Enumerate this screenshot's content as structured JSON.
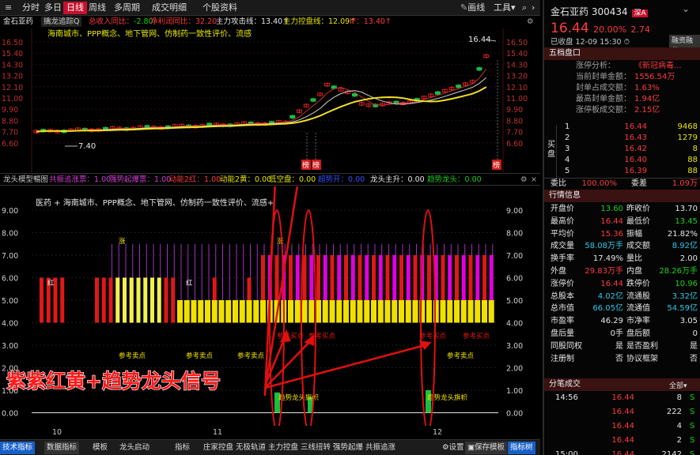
{
  "toolbar": {
    "tabs": [
      "分时",
      "多日",
      "日线",
      "周线",
      "多周期",
      "成交明细",
      "个股资料"
    ],
    "active_tab": "日线",
    "right_buttons": [
      "画线",
      "工具"
    ]
  },
  "info_line": {
    "stock": "金石亚药",
    "indicator": "擒龙追踪Q",
    "items": [
      {
        "label": "总收入同比：",
        "value": "-2.80"
      },
      {
        "label": "净利润同比：",
        "value": "32.20"
      },
      {
        "label": "主力攻击线：",
        "value": "13.40↑"
      },
      {
        "label": "主力控盘线：",
        "value": "12.09↑"
      },
      {
        "label": "IF：",
        "value": "13.40↑"
      }
    ],
    "concepts": "海南城市、PPP概念、地下管网、仿制药一致性评价、流感"
  },
  "price_chart": {
    "y_ticks": [
      "16.50",
      "15.40",
      "14.30",
      "13.20",
      "12.10",
      "11.00",
      "9.90",
      "8.80",
      "7.70",
      "6.60"
    ],
    "high_label": "16.44",
    "low_label": "7.40",
    "badges": [
      "榜",
      "榜",
      "榜"
    ]
  },
  "mid_bar": {
    "title": "龙头模型暢图",
    "items": [
      {
        "label": "共振追涨票：",
        "value": "1.00"
      },
      {
        "label": "强势起爆票：",
        "value": "1.00"
      },
      {
        "label": "动能2红：",
        "value": "1.00"
      },
      {
        "label": "动能2黄：",
        "value": "0.00"
      },
      {
        "label": "低空盘：",
        "value": "0.00"
      },
      {
        "label": "超势开：",
        "value": "0.00"
      },
      {
        "label": "龙头主升：",
        "value": "0.00"
      },
      {
        "label": "趋势龙头：",
        "value": "0.00"
      }
    ]
  },
  "signal_chart": {
    "concepts": "医药 + 海南城市、PPP概念、地下管网、仿制药一致性评价、流感+",
    "y_ticks": [
      "9.00",
      "8.00",
      "7.00",
      "6.00",
      "5.00",
      "4.00",
      "3.00",
      "2.00",
      "1.00",
      "0.00"
    ],
    "tag_red": "红",
    "tag_zhang": "涨",
    "ref_buy": "参考买点",
    "ref_sell": "参考卖点",
    "trend_flag": "趋势龙头旗帜",
    "annotation": "紫紫红黄+趋势龙头信号"
  },
  "x_axis": {
    "labels": [
      "10",
      "11",
      "12"
    ]
  },
  "bottom_tabs": [
    "技术指标",
    "数据指标",
    "模板",
    "龙头启动",
    "指标",
    "庄家控盘",
    "无极轨道",
    "主力控盘",
    "三线扭转",
    "强势起爆",
    "共振追涨"
  ],
  "bottom_right": [
    "设置",
    "保存模板",
    "指标树"
  ],
  "quote": {
    "name": "金石亚药",
    "code": "300434",
    "market": "深A",
    "price": "16.44",
    "change_pct": "20.00%",
    "change": "2.74",
    "status": "已收盘",
    "date": "12-09",
    "time": "15:30",
    "panel_btn": "融资融券"
  },
  "fivelevel": {
    "title": "五档盘口",
    "rows": [
      {
        "label": "涨停分析：",
        "value": "《新冠病毒..."
      },
      {
        "label": "当前封单金额：",
        "value": "1556.54万"
      },
      {
        "label": "封单占成交额：",
        "value": "1.63%"
      },
      {
        "label": "最高封单金额：",
        "value": "1.94亿"
      },
      {
        "label": "涨停板成交额：",
        "value": "2.15亿"
      }
    ],
    "side_label": "买盘",
    "bids": [
      {
        "lvl": "1",
        "price": "16.44",
        "vol": "9468"
      },
      {
        "lvl": "2",
        "price": "16.43",
        "vol": "1279"
      },
      {
        "lvl": "3",
        "price": "16.42",
        "vol": "8"
      },
      {
        "lvl": "4",
        "price": "16.40",
        "vol": "88"
      },
      {
        "lvl": "5",
        "price": "16.39",
        "vol": "88"
      }
    ],
    "weibi_label": "委比",
    "weibi": "100.00%",
    "weicha_label": "委差",
    "weicha": "1.09万"
  },
  "quotes_info": {
    "title": "行情信息",
    "rows": [
      {
        "l1": "开盘价",
        "v1": "13.60",
        "c1": "green",
        "l2": "昨收价",
        "v2": "13.70",
        "c2": "white"
      },
      {
        "l1": "最高价",
        "v1": "16.44",
        "c1": "red",
        "l2": "最低价",
        "v2": "13.45",
        "c2": "green"
      },
      {
        "l1": "平均价",
        "v1": "15.36",
        "c1": "red",
        "l2": "振幅",
        "v2": "21.82%",
        "c2": "white"
      },
      {
        "l1": "成交量",
        "v1": "58.08万手",
        "c1": "cyan",
        "l2": "成交额",
        "v2": "8.92亿",
        "c2": "cyan"
      },
      {
        "l1": "换手率",
        "v1": "17.49%",
        "c1": "white",
        "l2": "量比",
        "v2": "2.00",
        "c2": "white"
      },
      {
        "l1": "外盘",
        "v1": "29.83万手",
        "c1": "red",
        "l2": "内盘",
        "v2": "28.26万手",
        "c2": "green"
      },
      {
        "l1": "涨停价",
        "v1": "16.44",
        "c1": "red",
        "l2": "跌停价",
        "v2": "10.96",
        "c2": "green"
      },
      {
        "l1": "总股本",
        "v1": "4.02亿",
        "c1": "cyan",
        "l2": "流通股",
        "v2": "3.32亿",
        "c2": "cyan"
      },
      {
        "l1": "总市值",
        "v1": "66.05亿",
        "c1": "cyan",
        "l2": "流通值",
        "v2": "54.59亿",
        "c2": "cyan"
      },
      {
        "l1": "市盈率",
        "v1": "46.29",
        "c1": "white",
        "l2": "市净率",
        "v2": "3.05",
        "c2": "white"
      },
      {
        "l1": "盘后量",
        "v1": "0手",
        "c1": "white",
        "l2": "盘后额",
        "v2": "0",
        "c2": "white"
      },
      {
        "l1": "同股同权",
        "v1": "是",
        "c1": "white",
        "l2": "是否盈利",
        "v2": "是",
        "c2": "white"
      },
      {
        "l1": "注册制",
        "v1": "否",
        "c1": "white",
        "l2": "协议框架",
        "v2": "否",
        "c2": "white"
      }
    ]
  },
  "ticks": {
    "title": "分笔成交",
    "all_btn": "全部",
    "rows": [
      {
        "time": "14:56",
        "price": "16.44",
        "vol": "8",
        "flag": "S"
      },
      {
        "time": "",
        "price": "16.44",
        "vol": "222",
        "flag": "S"
      },
      {
        "time": "",
        "price": "16.44",
        "vol": "4",
        "flag": "S"
      },
      {
        "time": "",
        "price": "16.44",
        "vol": "2",
        "flag": "S"
      },
      {
        "time": "15:00",
        "price": "16.44",
        "vol": "2142",
        "flag": "S"
      }
    ]
  }
}
